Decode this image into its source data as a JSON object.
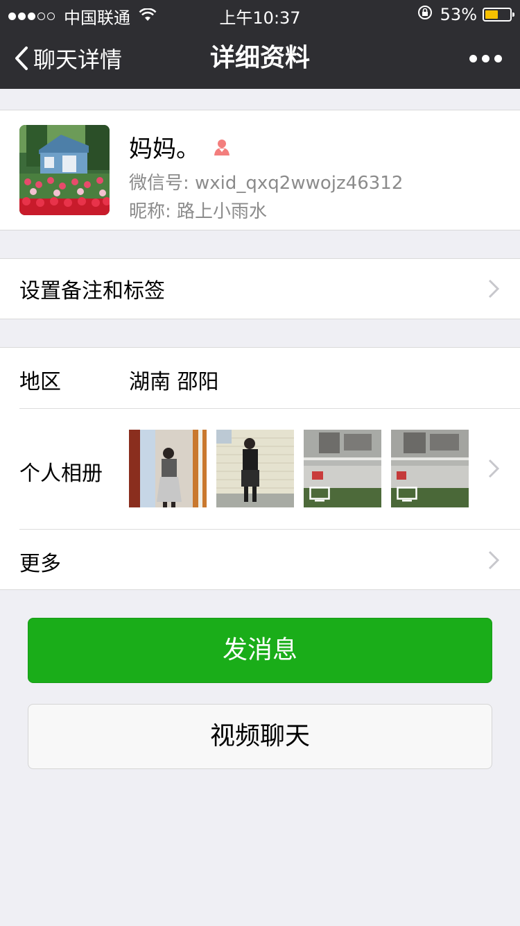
{
  "status_bar": {
    "carrier": "中国联通",
    "time": "上午10:37",
    "battery_percent": "53%",
    "battery_level": 0.53,
    "signal_bars": 3,
    "signal_total": 5,
    "icons": [
      "wifi-icon",
      "rotation-lock-icon",
      "battery-icon"
    ]
  },
  "nav": {
    "back_label": "聊天详情",
    "title": "详细资料",
    "more_icon": "more-dots-icon"
  },
  "profile": {
    "name": "妈妈。",
    "gender_icon": "female-icon",
    "wechat_id": "微信号:  wxid_qxq2wwojz46312",
    "nickname": "昵称:  路上小雨水"
  },
  "remark": {
    "label": "设置备注和标签"
  },
  "info": {
    "region_label": "地区",
    "region_value": "湖南 邵阳",
    "album_label": "个人相册",
    "more_label": "更多"
  },
  "buttons": {
    "message": "发消息",
    "video_chat": "视频聊天"
  },
  "colors": {
    "nav_bg": "#2e2e32",
    "accent_green": "#1aad19",
    "page_bg": "#efeff4",
    "female_icon": "#f37e7d"
  }
}
